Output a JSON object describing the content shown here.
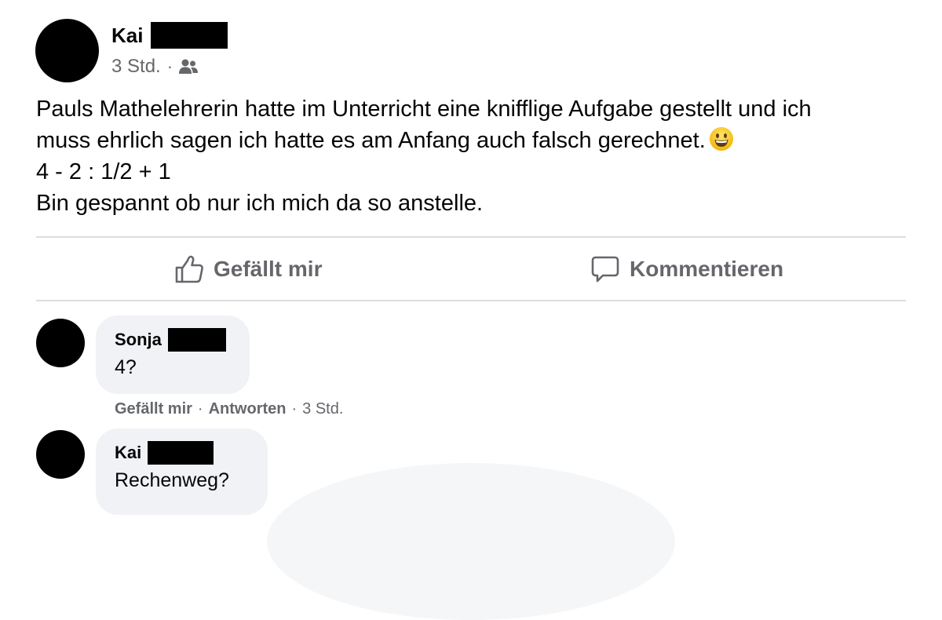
{
  "post": {
    "author": "Kai",
    "time": "3 Std.",
    "separator": "·",
    "audience_icon": "friends-icon",
    "body_lines": [
      "Pauls Mathelehrerin hatte im Unterricht eine knifflige Aufgabe gestellt und ich",
      "muss ehrlich sagen ich hatte es am Anfang auch falsch gerechnet.",
      "4 - 2 : 1/2 + 1",
      "Bin gespannt ob nur ich mich da so anstelle."
    ],
    "emoji": "grinning-face-emoji"
  },
  "actions": {
    "like_label": "Gefällt mir",
    "comment_label": "Kommentieren"
  },
  "comments": [
    {
      "author": "Sonja",
      "text": "4?",
      "like_label": "Gefällt mir",
      "reply_label": "Antworten",
      "separator": "·",
      "time": "3 Std."
    },
    {
      "author": "Kai",
      "text": "Rechenweg?"
    }
  ],
  "colors": {
    "text": "#050505",
    "secondary": "#65676b",
    "bubble": "#f0f2f5",
    "divider": "#dadde1"
  }
}
